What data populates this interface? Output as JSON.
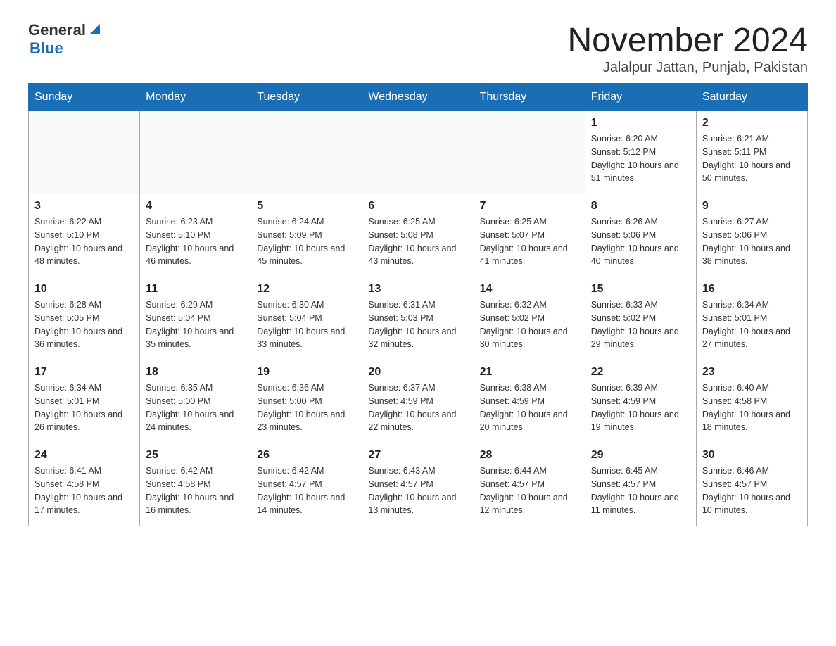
{
  "header": {
    "logo_general": "General",
    "logo_blue": "Blue",
    "month_title": "November 2024",
    "location": "Jalalpur Jattan, Punjab, Pakistan"
  },
  "weekdays": [
    "Sunday",
    "Monday",
    "Tuesday",
    "Wednesday",
    "Thursday",
    "Friday",
    "Saturday"
  ],
  "weeks": [
    [
      {
        "day": "",
        "info": ""
      },
      {
        "day": "",
        "info": ""
      },
      {
        "day": "",
        "info": ""
      },
      {
        "day": "",
        "info": ""
      },
      {
        "day": "",
        "info": ""
      },
      {
        "day": "1",
        "info": "Sunrise: 6:20 AM\nSunset: 5:12 PM\nDaylight: 10 hours and 51 minutes."
      },
      {
        "day": "2",
        "info": "Sunrise: 6:21 AM\nSunset: 5:11 PM\nDaylight: 10 hours and 50 minutes."
      }
    ],
    [
      {
        "day": "3",
        "info": "Sunrise: 6:22 AM\nSunset: 5:10 PM\nDaylight: 10 hours and 48 minutes."
      },
      {
        "day": "4",
        "info": "Sunrise: 6:23 AM\nSunset: 5:10 PM\nDaylight: 10 hours and 46 minutes."
      },
      {
        "day": "5",
        "info": "Sunrise: 6:24 AM\nSunset: 5:09 PM\nDaylight: 10 hours and 45 minutes."
      },
      {
        "day": "6",
        "info": "Sunrise: 6:25 AM\nSunset: 5:08 PM\nDaylight: 10 hours and 43 minutes."
      },
      {
        "day": "7",
        "info": "Sunrise: 6:25 AM\nSunset: 5:07 PM\nDaylight: 10 hours and 41 minutes."
      },
      {
        "day": "8",
        "info": "Sunrise: 6:26 AM\nSunset: 5:06 PM\nDaylight: 10 hours and 40 minutes."
      },
      {
        "day": "9",
        "info": "Sunrise: 6:27 AM\nSunset: 5:06 PM\nDaylight: 10 hours and 38 minutes."
      }
    ],
    [
      {
        "day": "10",
        "info": "Sunrise: 6:28 AM\nSunset: 5:05 PM\nDaylight: 10 hours and 36 minutes."
      },
      {
        "day": "11",
        "info": "Sunrise: 6:29 AM\nSunset: 5:04 PM\nDaylight: 10 hours and 35 minutes."
      },
      {
        "day": "12",
        "info": "Sunrise: 6:30 AM\nSunset: 5:04 PM\nDaylight: 10 hours and 33 minutes."
      },
      {
        "day": "13",
        "info": "Sunrise: 6:31 AM\nSunset: 5:03 PM\nDaylight: 10 hours and 32 minutes."
      },
      {
        "day": "14",
        "info": "Sunrise: 6:32 AM\nSunset: 5:02 PM\nDaylight: 10 hours and 30 minutes."
      },
      {
        "day": "15",
        "info": "Sunrise: 6:33 AM\nSunset: 5:02 PM\nDaylight: 10 hours and 29 minutes."
      },
      {
        "day": "16",
        "info": "Sunrise: 6:34 AM\nSunset: 5:01 PM\nDaylight: 10 hours and 27 minutes."
      }
    ],
    [
      {
        "day": "17",
        "info": "Sunrise: 6:34 AM\nSunset: 5:01 PM\nDaylight: 10 hours and 26 minutes."
      },
      {
        "day": "18",
        "info": "Sunrise: 6:35 AM\nSunset: 5:00 PM\nDaylight: 10 hours and 24 minutes."
      },
      {
        "day": "19",
        "info": "Sunrise: 6:36 AM\nSunset: 5:00 PM\nDaylight: 10 hours and 23 minutes."
      },
      {
        "day": "20",
        "info": "Sunrise: 6:37 AM\nSunset: 4:59 PM\nDaylight: 10 hours and 22 minutes."
      },
      {
        "day": "21",
        "info": "Sunrise: 6:38 AM\nSunset: 4:59 PM\nDaylight: 10 hours and 20 minutes."
      },
      {
        "day": "22",
        "info": "Sunrise: 6:39 AM\nSunset: 4:59 PM\nDaylight: 10 hours and 19 minutes."
      },
      {
        "day": "23",
        "info": "Sunrise: 6:40 AM\nSunset: 4:58 PM\nDaylight: 10 hours and 18 minutes."
      }
    ],
    [
      {
        "day": "24",
        "info": "Sunrise: 6:41 AM\nSunset: 4:58 PM\nDaylight: 10 hours and 17 minutes."
      },
      {
        "day": "25",
        "info": "Sunrise: 6:42 AM\nSunset: 4:58 PM\nDaylight: 10 hours and 16 minutes."
      },
      {
        "day": "26",
        "info": "Sunrise: 6:42 AM\nSunset: 4:57 PM\nDaylight: 10 hours and 14 minutes."
      },
      {
        "day": "27",
        "info": "Sunrise: 6:43 AM\nSunset: 4:57 PM\nDaylight: 10 hours and 13 minutes."
      },
      {
        "day": "28",
        "info": "Sunrise: 6:44 AM\nSunset: 4:57 PM\nDaylight: 10 hours and 12 minutes."
      },
      {
        "day": "29",
        "info": "Sunrise: 6:45 AM\nSunset: 4:57 PM\nDaylight: 10 hours and 11 minutes."
      },
      {
        "day": "30",
        "info": "Sunrise: 6:46 AM\nSunset: 4:57 PM\nDaylight: 10 hours and 10 minutes."
      }
    ]
  ]
}
